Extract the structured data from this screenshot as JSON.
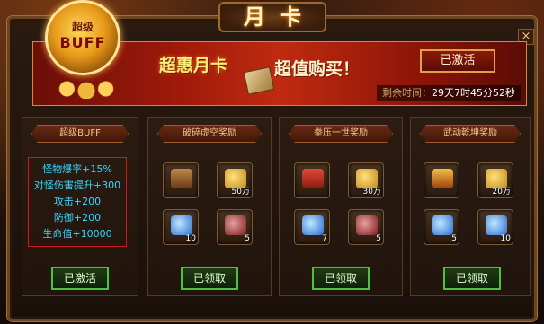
{
  "window": {
    "title": "月卡",
    "close_glyph": "×"
  },
  "banner": {
    "badge_top": "超级",
    "badge_main": "BUFF",
    "title": "超惠月卡",
    "subtitle": "超值购买！",
    "activated_button": "已激活",
    "countdown_label": "剩余时间：",
    "countdown_value": "29天7时45分52秒"
  },
  "panels": [
    {
      "header": "超级BUFF",
      "stats": [
        "怪物爆率+15%",
        "对怪伤害提升+300",
        "攻击+200",
        "防御+200",
        "生命值+10000"
      ],
      "button": "已激活"
    },
    {
      "header": "破碎虚空奖励",
      "items": [
        {
          "icon": "chest-icon",
          "qty": ""
        },
        {
          "icon": "gold-icon",
          "qty": "50万"
        },
        {
          "icon": "blue-gem-icon",
          "qty": "10"
        },
        {
          "icon": "red-gem-icon",
          "qty": "5"
        }
      ],
      "button": "已领取"
    },
    {
      "header": "拳压一世奖励",
      "items": [
        {
          "icon": "gift-icon",
          "qty": ""
        },
        {
          "icon": "gold-icon",
          "qty": "30万"
        },
        {
          "icon": "blue-gem-icon",
          "qty": "7"
        },
        {
          "icon": "red-gem-icon",
          "qty": "5"
        }
      ],
      "button": "已领取"
    },
    {
      "header": "武动乾坤奖励",
      "items": [
        {
          "icon": "armor-icon",
          "qty": ""
        },
        {
          "icon": "gold-icon",
          "qty": "20万"
        },
        {
          "icon": "blue-gem-icon",
          "qty": "5"
        },
        {
          "icon": "blue-gem-icon",
          "qty": "10"
        }
      ],
      "button": "已领取"
    }
  ],
  "colors": {
    "stat_text": "#35d6ff",
    "claim_border": "#4fc23a",
    "stats_border": "#d01a1a"
  }
}
